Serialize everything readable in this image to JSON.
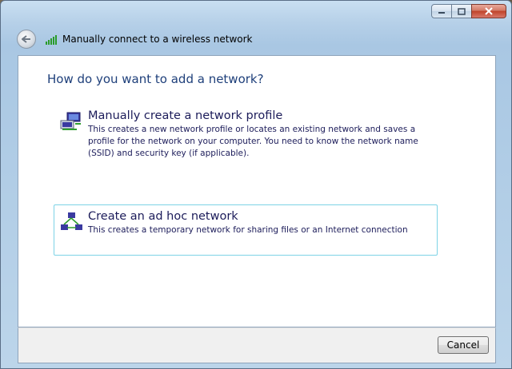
{
  "window": {
    "title": "Manually connect to a wireless network"
  },
  "caption_buttons": {
    "minimize": "minimize-icon",
    "maximize": "maximize-icon",
    "close": "close-icon"
  },
  "main": {
    "heading": "How do you want to add a network?",
    "options": [
      {
        "title": "Manually create a network profile",
        "description": "This creates a new network profile or locates an existing network and saves a profile for the network on your computer. You need to know the network name (SSID) and security key (if applicable).",
        "icon": "network-profile-icon"
      },
      {
        "title": "Create an ad hoc network",
        "description": "This creates a temporary network for sharing files or an Internet connection",
        "icon": "ad-hoc-network-icon"
      }
    ]
  },
  "footer": {
    "cancel_label": "Cancel"
  },
  "colors": {
    "heading": "#1e3f7a",
    "selected_border": "#7dd3e6"
  }
}
